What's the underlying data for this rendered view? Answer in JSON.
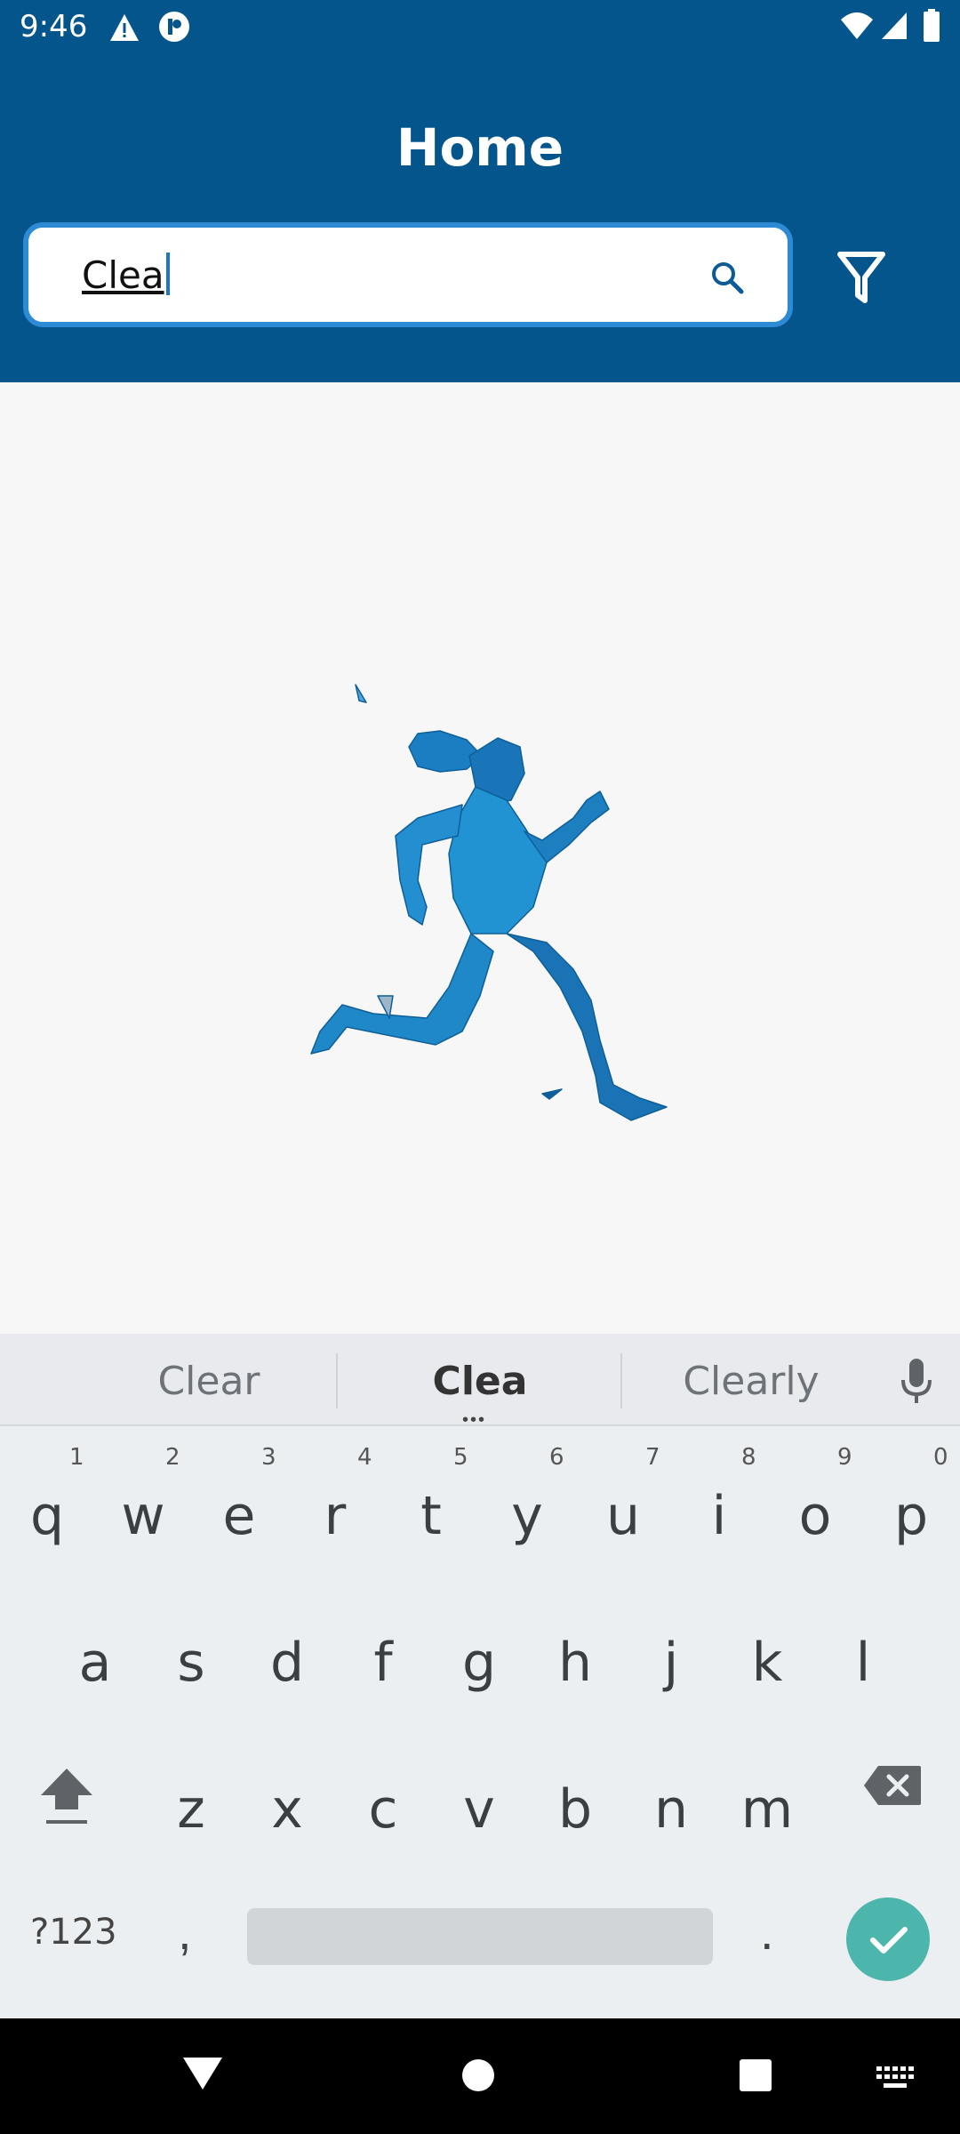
{
  "status_bar": {
    "time": "9:46"
  },
  "app_bar": {
    "title": "Home"
  },
  "search": {
    "value": "Clea"
  },
  "keyboard": {
    "suggestions": [
      "Clear",
      "Clea",
      "Clearly"
    ],
    "row1": [
      "q",
      "w",
      "e",
      "r",
      "t",
      "y",
      "u",
      "i",
      "o",
      "p"
    ],
    "row1_numbers": [
      "1",
      "2",
      "3",
      "4",
      "5",
      "6",
      "7",
      "8",
      "9",
      "0"
    ],
    "row2": [
      "a",
      "s",
      "d",
      "f",
      "g",
      "h",
      "j",
      "k",
      "l"
    ],
    "row3": [
      "z",
      "x",
      "c",
      "v",
      "b",
      "n",
      "m"
    ],
    "symbols_label": "?123",
    "comma": ",",
    "period": "."
  },
  "colors": {
    "app_bar": "#03558c",
    "accent": "#2d8bd6",
    "enter": "#4db6ac"
  }
}
